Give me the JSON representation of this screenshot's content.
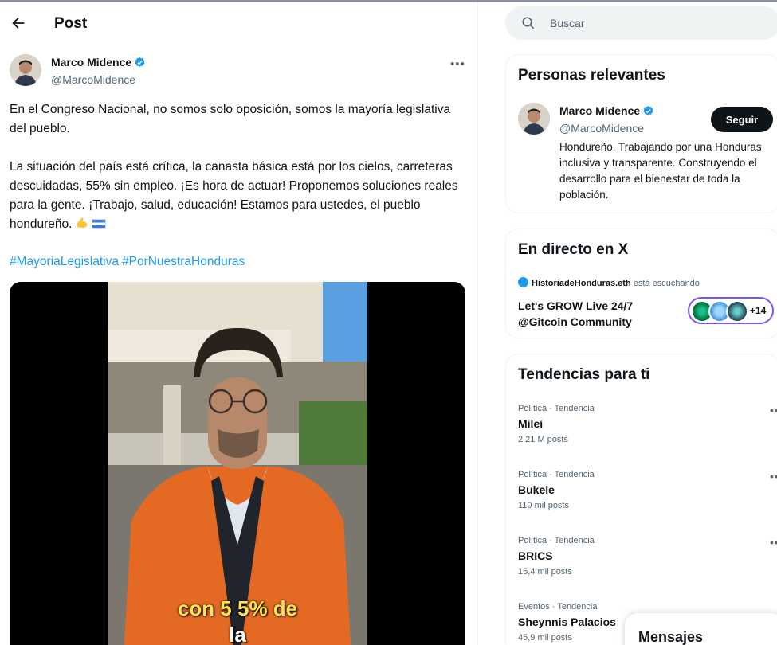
{
  "header": {
    "title": "Post"
  },
  "post": {
    "author_name": "Marco Midence",
    "author_handle": "@MarcoMidence",
    "paragraph_1": "En el Congreso Nacional, no somos solo oposición, somos la mayoría legislativa del pueblo.",
    "paragraph_2": "La situación del país está crítica, la canasta básica está por los cielos, carreteras descuidadas, 55% sin empleo. ¡Es hora de actuar! Proponemos soluciones reales para la gente. ¡Trabajo, salud, educación! Estamos para ustedes, el pueblo hondureño.",
    "hashtags": [
      "#MayoriaLegislativa",
      "#PorNuestraHonduras"
    ],
    "video_caption_1": "con 5 5% de",
    "video_caption_2": "la"
  },
  "search": {
    "placeholder": "Buscar"
  },
  "relevant": {
    "title": "Personas relevantes",
    "name": "Marco Midence",
    "handle": "@MarcoMidence",
    "follow_label": "Seguir",
    "bio": "Hondureño. Trabajando por una Honduras inclusiva y transparente. Construyendo el desarrollo para el bienestar de toda la población."
  },
  "live": {
    "title": "En directo en X",
    "host": "HistoriadeHonduras.eth",
    "host_status": "está escuchando",
    "space_title": "Let's GROW Live 24/7 @Gitcoin Community",
    "listener_extra": "+14"
  },
  "trends": {
    "title": "Tendencias para ti",
    "items": [
      {
        "meta": "Política · Tendencia",
        "name": "Milei",
        "count": "2,21 M posts"
      },
      {
        "meta": "Política · Tendencia",
        "name": "Bukele",
        "count": "110 mil posts"
      },
      {
        "meta": "Política · Tendencia",
        "name": "BRICS",
        "count": "15,4 mil posts"
      },
      {
        "meta": "Eventos · Tendencia",
        "name": "Sheynnis Palacios",
        "count": "45,9 mil posts"
      }
    ]
  },
  "messages": {
    "title": "Mensajes"
  },
  "colors": {
    "accent": "#1d9bf0",
    "text": "#0f1419",
    "muted": "#536471",
    "live_ring": "#7856ff"
  }
}
